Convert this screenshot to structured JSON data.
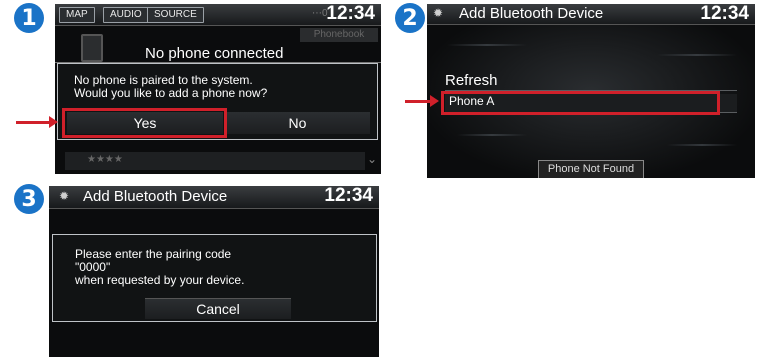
{
  "steps": [
    "1",
    "2",
    "3"
  ],
  "screen1": {
    "topbar_buttons": [
      "MAP",
      "AUDIO",
      "SOURCE"
    ],
    "clock": "12:34",
    "status_title": "No phone connected",
    "phonebook_label": "Phonebook",
    "dialog_text": "No phone is paired to the system.\nWould you like to add a phone now?",
    "yes_label": "Yes",
    "no_label": "No",
    "bottom_item": "★★★★"
  },
  "screen2": {
    "title": "Add Bluetooth Device",
    "clock": "12:34",
    "refresh_label": "Refresh",
    "device_label": "Phone A",
    "not_found_label": "Phone Not Found"
  },
  "screen3": {
    "title": "Add Bluetooth Device",
    "clock": "12:34",
    "dialog_text": "Please enter the pairing code\n\"0000\"\nwhen requested by your device.",
    "cancel_label": "Cancel"
  },
  "colors": {
    "highlight": "#d0202a",
    "badge": "#1a73c7"
  },
  "icons": [
    "gear-icon",
    "phone-icon",
    "signal-icon",
    "chevron-down-icon",
    "arrow-right-icon"
  ]
}
